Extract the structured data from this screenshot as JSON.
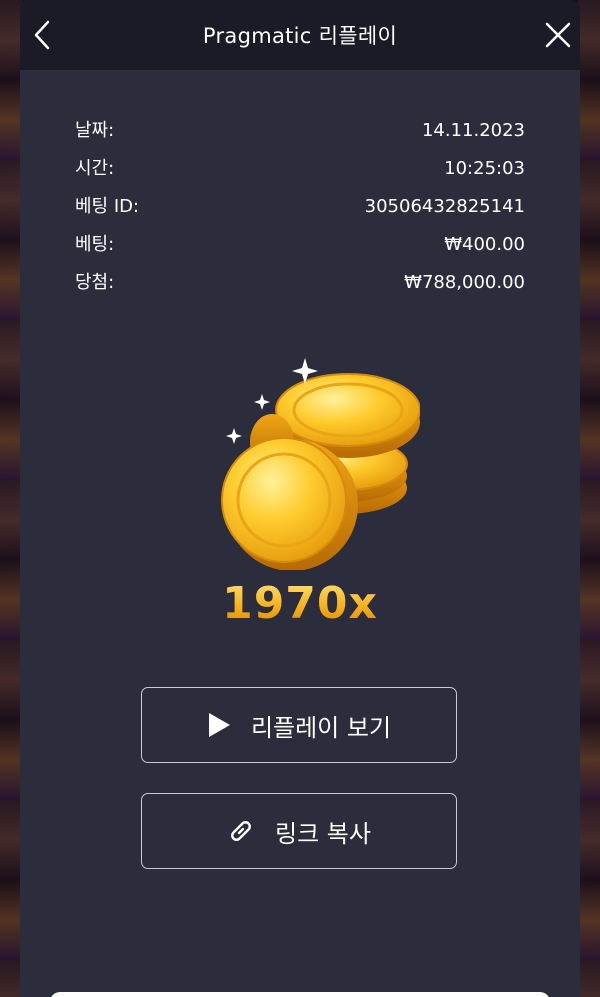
{
  "header": {
    "title": "Pragmatic 리플레이",
    "back_icon": "chevron-left-icon",
    "close_icon": "close-icon"
  },
  "info": {
    "rows": [
      {
        "label": "날짜:",
        "value": "14.11.2023"
      },
      {
        "label": "시간:",
        "value": "10:25:03"
      },
      {
        "label": "베팅 ID:",
        "value": "30506432825141"
      },
      {
        "label": "베팅:",
        "value": "₩400.00"
      },
      {
        "label": "당첨:",
        "value": "₩788,000.00"
      }
    ]
  },
  "win": {
    "icon": "gold-coins-icon",
    "multiplier": "1970x"
  },
  "buttons": {
    "replay_label": "리플레이 보기",
    "replay_icon": "play-icon",
    "copy_label": "링크 복사",
    "copy_icon": "link-icon"
  },
  "colors": {
    "modal_bg": "#2b2c3c",
    "header_bg": "#1a1b26",
    "accent_gold": "#f6b21c"
  }
}
